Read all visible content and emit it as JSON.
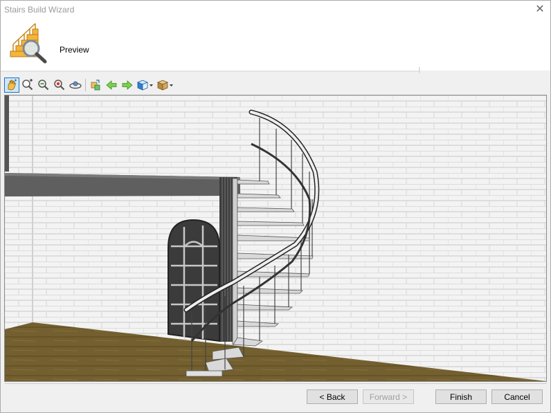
{
  "window": {
    "title": "Stairs Build Wizard",
    "close_glyph": "✕"
  },
  "header": {
    "title": "Preview",
    "icon": "stairs-magnifier-icon"
  },
  "toolbar": {
    "tools": [
      {
        "icon": "pan-hand-icon",
        "active": true
      },
      {
        "icon": "zoom-in-icon"
      },
      {
        "icon": "zoom-out-icon"
      },
      {
        "icon": "zoom-extents-icon"
      },
      {
        "icon": "orbit-icon"
      },
      {
        "icon": "walk-icon"
      },
      {
        "icon": "arrow-left-icon"
      },
      {
        "icon": "arrow-right-icon"
      },
      {
        "icon": "view-cube-icon",
        "dropdown": true
      },
      {
        "icon": "render-box-icon",
        "dropdown": true
      }
    ]
  },
  "footer": {
    "back_label": "< Back",
    "forward_label": "Forward >",
    "finish_label": "Finish",
    "cancel_label": "Cancel"
  },
  "colors": {
    "accent": "#1a73c0",
    "floor": "#6b5a2e",
    "wall": "#f2f2f2",
    "beam": "#5e5e5e"
  }
}
